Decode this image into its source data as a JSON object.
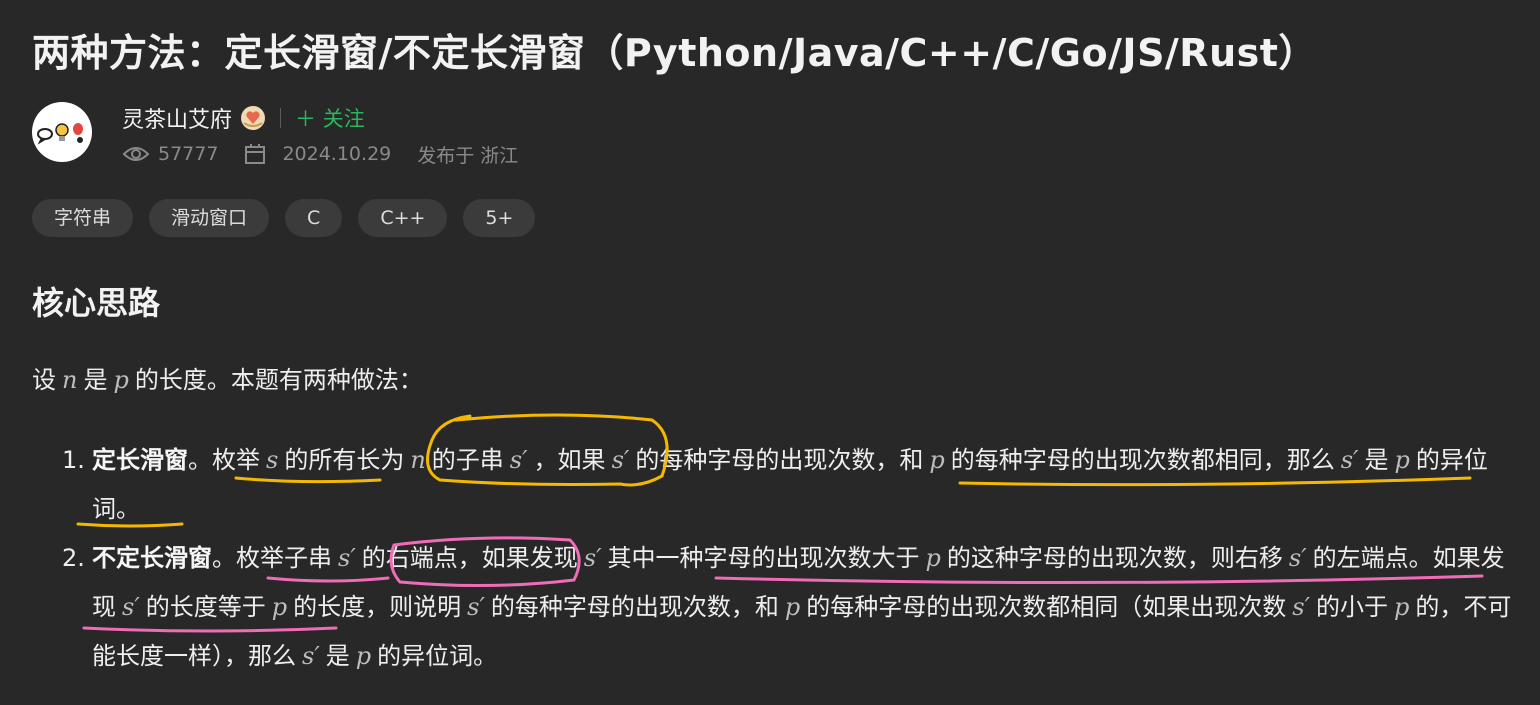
{
  "title": "两种方法：定长滑窗/不定长滑窗（Python/Java/C++/C/Go/JS/Rust）",
  "author": {
    "name": "灵茶山艾府",
    "follow_label": "＋ 关注"
  },
  "meta": {
    "views": "57777",
    "date": "2024.10.29",
    "location": "发布于 浙江",
    "views_icon": "eye-icon",
    "date_icon": "calendar-icon"
  },
  "tags": [
    "字符串",
    "滑动窗口",
    "C",
    "C++",
    "5+"
  ],
  "section_title": "核心思路",
  "intro": {
    "t1": "设",
    "n": "n",
    "t2": "是",
    "p": "p",
    "t3": "的长度。本题有两种做法："
  },
  "items": [
    {
      "number": "1.",
      "strong": "定长滑窗",
      "parts": {
        "a": "。枚举",
        "s": "s",
        "b": "的所有长为",
        "n": "n",
        "c": "的子串",
        "s1": "s′",
        "d": "，如果",
        "s2": "s′",
        "e": "的每种字母的出现次数，和",
        "p": "p",
        "f": "的每种字母的出现次数都相同，那么",
        "s3": "s′",
        "g": "是",
        "p2": "p",
        "h": "的异位词。"
      }
    },
    {
      "number": "2.",
      "strong": "不定长滑窗",
      "parts": {
        "a": "。枚举子串",
        "s1": "s′",
        "b": "的右端点，如果发现",
        "s2": "s′",
        "c": "其中一种字母的出现次数大于",
        "p": "p",
        "d": "的这种字母的出现次数，则右移",
        "s3": "s′",
        "e": "的左端点。如果发现",
        "s4": "s′",
        "f": "的长度等于",
        "p2": "p",
        "g": "的长度，则说明",
        "s5": "s′",
        "h": "的每种字母的出现次数，和",
        "p3": "p",
        "i": "的每种字母的出现次数都相同（如果出现次数",
        "s6": "s′",
        "j": "的小于",
        "p4": "p",
        "k": "的，不可能长度一样），那么",
        "s7": "s′",
        "l": "是",
        "p5": "p",
        "m": "的异位词。"
      }
    }
  ],
  "colors": {
    "background": "#282828",
    "follow": "#2db55d",
    "highlight_yellow": "#f5b800",
    "highlight_pink": "#f06bb8"
  }
}
